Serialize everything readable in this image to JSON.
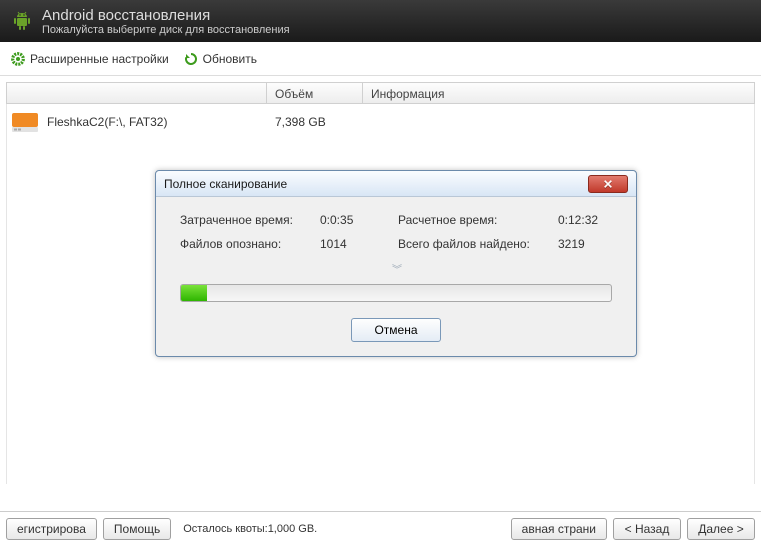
{
  "header": {
    "title": "Android восстановления",
    "subtitle": "Пожалуйста выберите диск для восстановления"
  },
  "toolbar": {
    "advanced": "Расширенные настройки",
    "refresh": "Обновить"
  },
  "columns": {
    "name": "",
    "volume": "Объём",
    "info": "Информация"
  },
  "drives": [
    {
      "name": "FleshkaC2(F:\\, FAT32)",
      "volume": "7,398 GB"
    }
  ],
  "dialog": {
    "title": "Полное сканирование",
    "elapsed_label": "Затраченное время:",
    "elapsed_value": "0:0:35",
    "estimated_label": "Расчетное время:",
    "estimated_value": "0:12:32",
    "recognized_label": "Файлов опознано:",
    "recognized_value": "1014",
    "found_label": "Всего файлов найдено:",
    "found_value": "3219",
    "cancel": "Отмена",
    "progress_percent": 6
  },
  "footer": {
    "register": "егистрирова",
    "help": "Помощь",
    "quota": "Осталось квоты:1,000 GB.",
    "home": "авная страни",
    "back": "< Назад",
    "next": "Далее >"
  }
}
